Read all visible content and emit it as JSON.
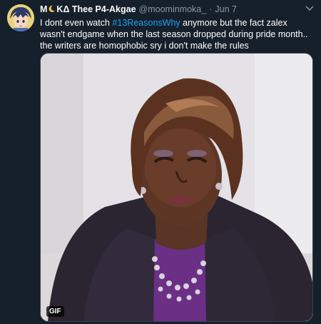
{
  "tweet": {
    "display_name_prefix": "M",
    "display_name_suffix": "KΔ Thee P4-Akgae",
    "handle": "@moominmoka_",
    "separator": "·",
    "time": "Jun 7",
    "text_before": "I dont even watch ",
    "hashtag": "#13ReasonsWhy",
    "text_after": " anymore but the fact zalex wasn't endgame when the last season dropped during pride month.. the writers are homophobic sry i don't make the rules"
  },
  "media": {
    "badge": "GIF",
    "type": "gif"
  },
  "icons": {
    "avatar": "anime-avatar",
    "name_emoji": "crescent-moon-icon",
    "menu": "chevron-down-icon"
  },
  "colors": {
    "background": "#15202b",
    "text": "#ffffff",
    "muted": "#8899a6",
    "link": "#1da1f2"
  }
}
